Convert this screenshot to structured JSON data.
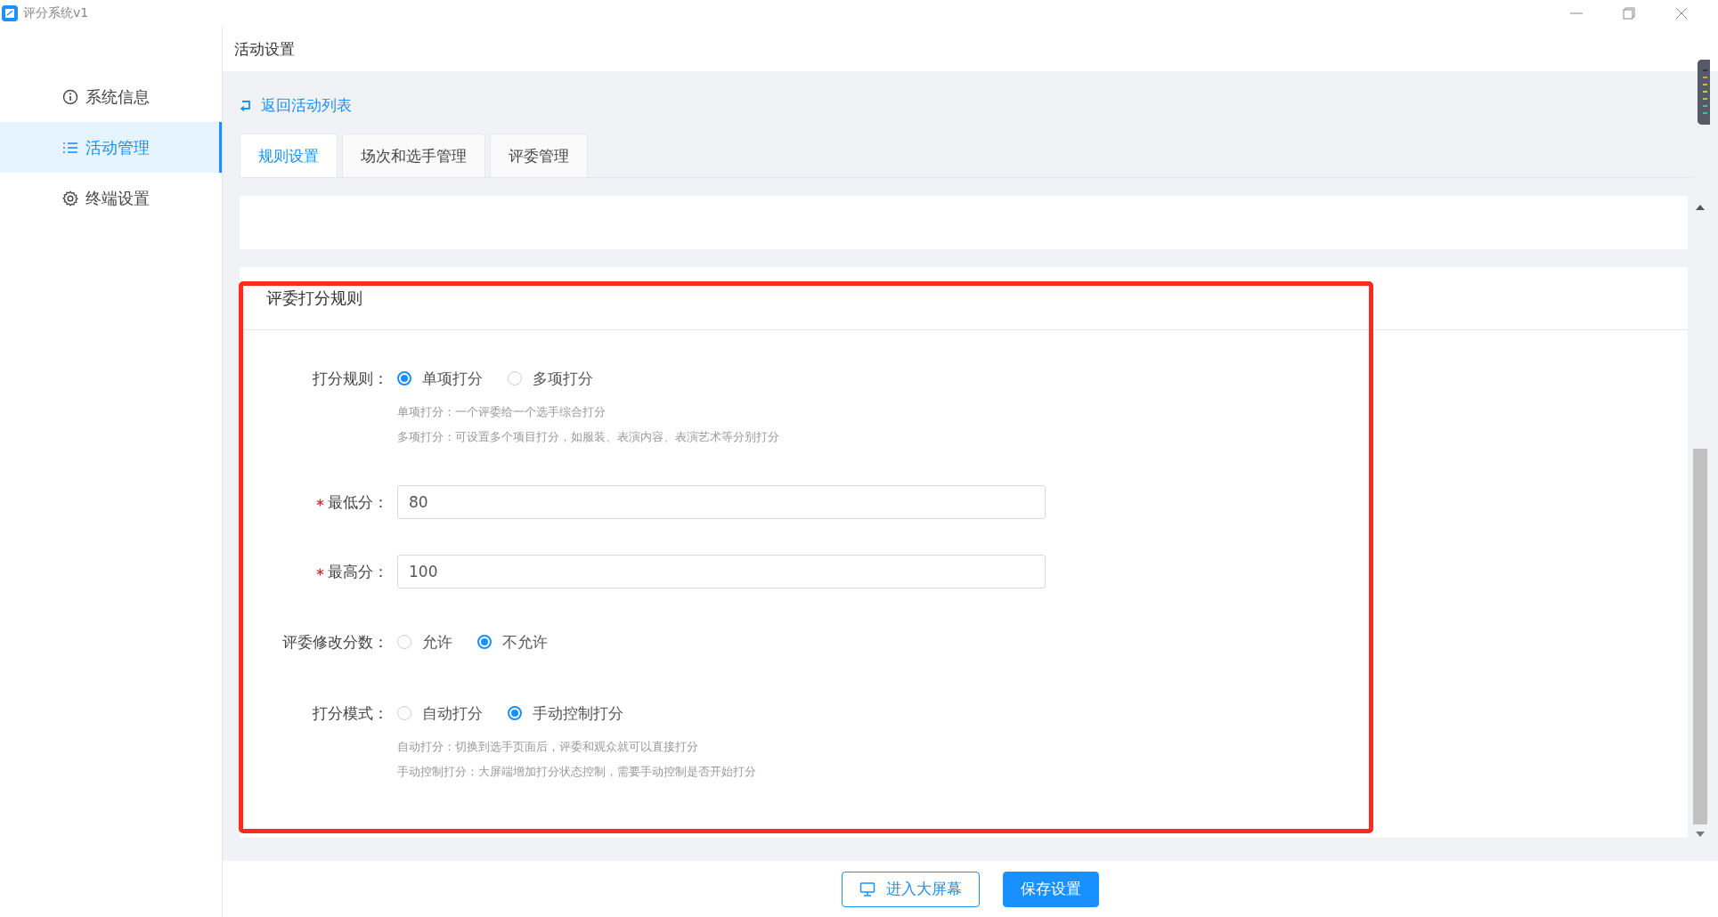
{
  "window": {
    "title": "评分系统v1"
  },
  "sidebar": {
    "items": [
      {
        "label": "系统信息",
        "selected": false
      },
      {
        "label": "活动管理",
        "selected": true
      },
      {
        "label": "终端设置",
        "selected": false
      }
    ]
  },
  "header": {
    "title": "活动设置"
  },
  "back_link": "返回活动列表",
  "tabs": [
    {
      "label": "规则设置",
      "selected": true
    },
    {
      "label": "场次和选手管理",
      "selected": false
    },
    {
      "label": "评委管理",
      "selected": false
    }
  ],
  "section": {
    "title": "评委打分规则",
    "fields": [
      {
        "kind": "radio",
        "label": "打分规则：",
        "required": false,
        "options": [
          {
            "label": "单项打分",
            "selected": true
          },
          {
            "label": "多项打分",
            "selected": false
          }
        ],
        "hints": [
          "单项打分：一个评委给一个选手综合打分",
          "多项打分：可设置多个项目打分，如服装、表演内容、表演艺术等分别打分"
        ]
      },
      {
        "kind": "input",
        "label": "最低分：",
        "required": true,
        "value": "80"
      },
      {
        "kind": "input",
        "label": "最高分：",
        "required": true,
        "value": "100"
      },
      {
        "kind": "radio",
        "label": "评委修改分数：",
        "required": false,
        "options": [
          {
            "label": "允许",
            "selected": false
          },
          {
            "label": "不允许",
            "selected": true
          }
        ]
      },
      {
        "kind": "radio",
        "label": "打分模式：",
        "required": false,
        "options": [
          {
            "label": "自动打分",
            "selected": false
          },
          {
            "label": "手动控制打分",
            "selected": true
          }
        ],
        "hints": [
          "自动打分：切换到选手页面后，评委和观众就可以直接打分",
          "手动控制打分：大屏端增加打分状态控制，需要手动控制是否开始打分"
        ]
      }
    ]
  },
  "buttons": [
    {
      "kind": "outline",
      "label": "进入大屏幕"
    },
    {
      "kind": "primary",
      "label": "保存设置"
    }
  ]
}
